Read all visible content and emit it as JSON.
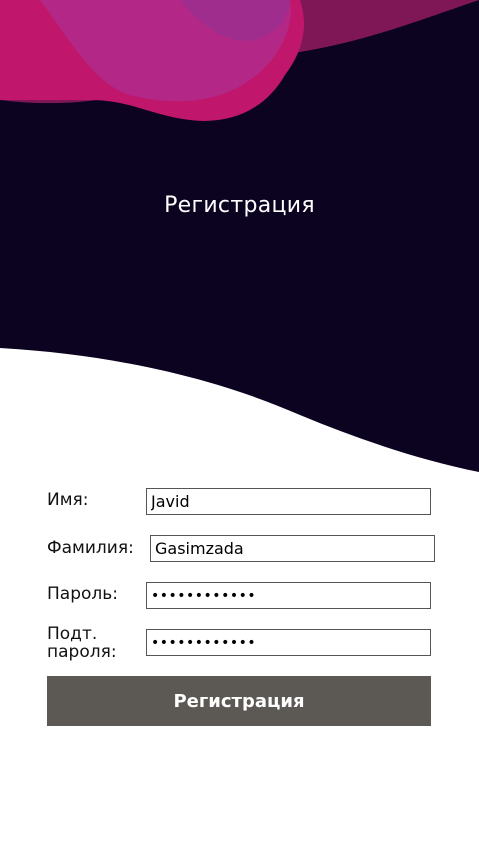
{
  "header": {
    "title": "Регистрация",
    "colors": {
      "background": "#0b0320",
      "blob_primary": "#c0166b",
      "blob_secondary": "#b02a8c",
      "blob_tertiary": "#8c1a5c"
    }
  },
  "form": {
    "first_name": {
      "label": "Имя:",
      "value": "Javid"
    },
    "last_name": {
      "label": "Фамилия:",
      "value": "Gasimzada"
    },
    "password": {
      "label": "Пароль:",
      "value": "••••••••••••"
    },
    "password_confirm": {
      "label_line1": "Подт.",
      "label_line2": "пароля:",
      "value": "••••••••••••"
    },
    "submit_label": "Регистрация"
  }
}
